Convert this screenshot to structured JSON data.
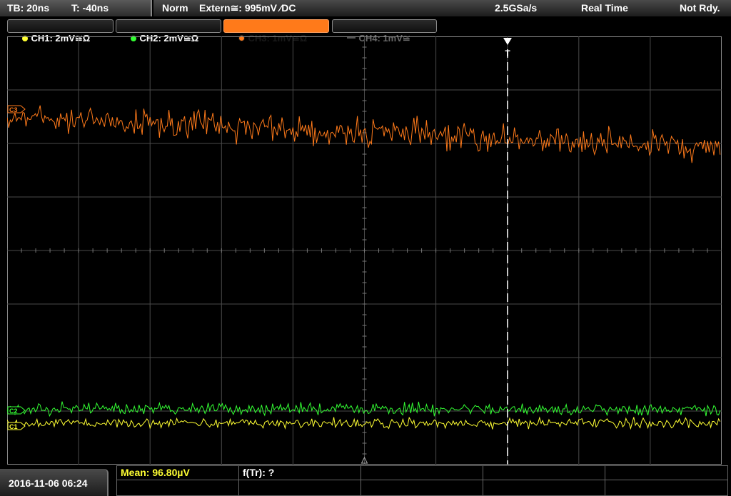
{
  "status": {
    "timebase": "TB: 20ns",
    "trigger_time": "T: -40ns",
    "mode": "Norm",
    "trigger_source": "Extern≅: 995mV ⁄DC",
    "sample_rate": "2.5GSa/s",
    "acq_mode": "Real Time",
    "state": "Not Rdy."
  },
  "channels": [
    {
      "id": "ch1",
      "label": "CH1: 2mV≅Ω",
      "color": "#ffff33",
      "active": true
    },
    {
      "id": "ch2",
      "label": "CH2: 2mV≅Ω",
      "color": "#33ff33",
      "active": true
    },
    {
      "id": "ch3",
      "label": "CH3: 1mV≅Ω",
      "color": "#ff7a1a",
      "active": true,
      "selected": true
    },
    {
      "id": "ch4",
      "label": "CH4: 1mV≅",
      "color": "#555555",
      "active": false
    }
  ],
  "markers": {
    "ch3": "C3",
    "ch2": "C2",
    "ch1": "C1",
    "trigger": "T"
  },
  "measurements": {
    "mean": "Mean: 96.80µV",
    "freq": "f(Tr): ?"
  },
  "timestamp": "2016-11-06 06:24",
  "colors": {
    "grid": "#4a4a4a",
    "ch1": "#ffff33",
    "ch2": "#33ff33",
    "ch3": "#ff7a1a",
    "mean_text": "#ffff33"
  }
}
